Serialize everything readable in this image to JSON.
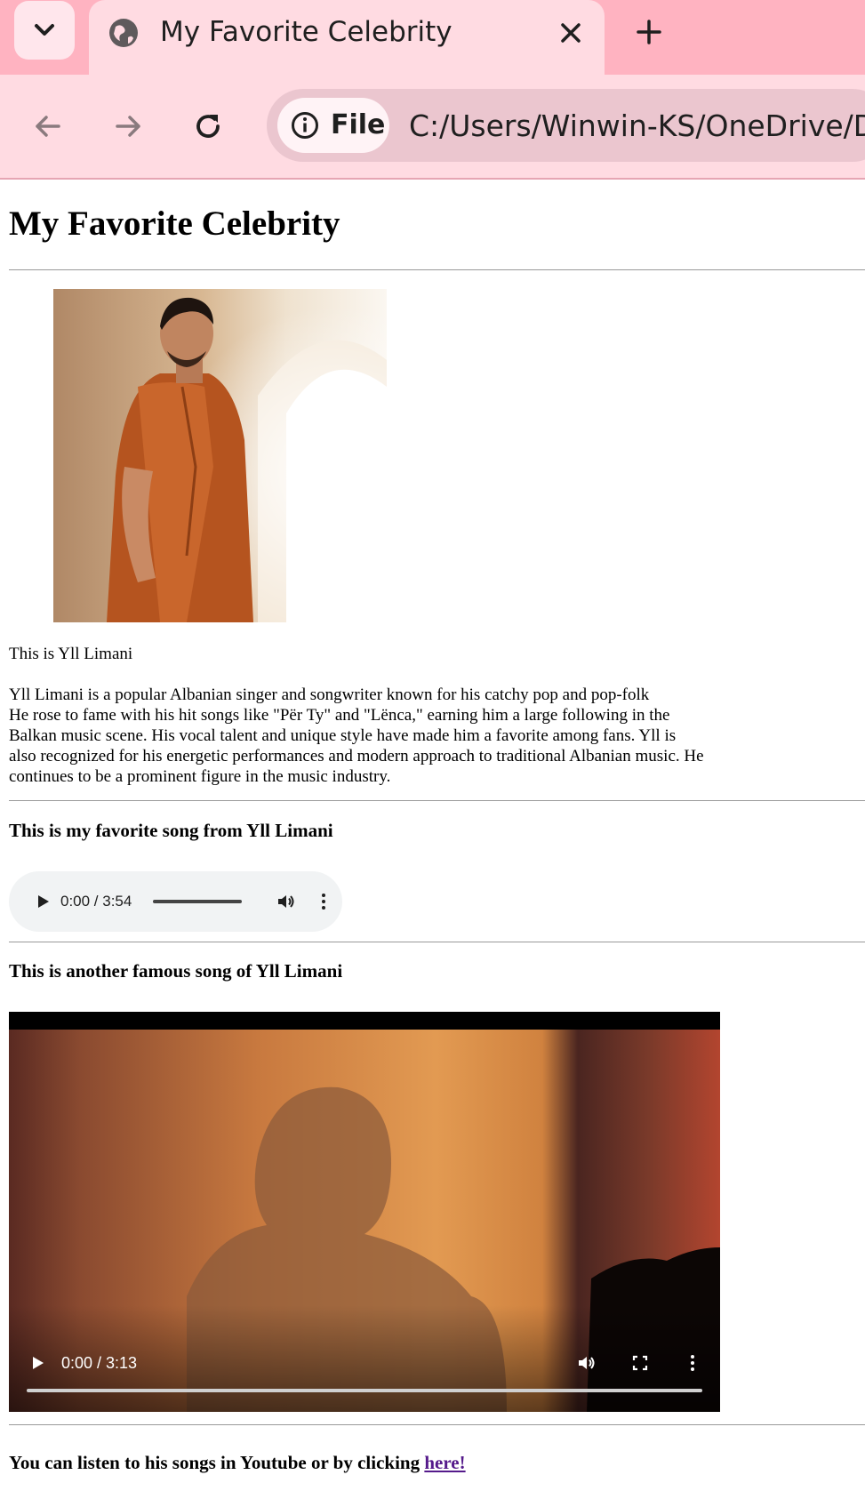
{
  "browser": {
    "tab": {
      "title": "My Favorite Celebrity",
      "close_icon": "close-icon",
      "favicon": "globe-icon"
    },
    "new_tab_icon": "plus-icon",
    "tab_search_icon": "chevron-down-icon",
    "nav": {
      "back_icon": "arrow-left-icon",
      "forward_icon": "arrow-right-icon",
      "reload_icon": "reload-icon"
    },
    "address": {
      "chip_label": "File",
      "chip_icon": "info-icon",
      "url": "C:/Users/Winwin-KS/OneDrive/Do"
    },
    "colors": {
      "tabstrip": "#ffb3c1",
      "toolbar": "#ffdbe2",
      "omnibox": "#ebc6cf"
    }
  },
  "page": {
    "title": "My Favorite Celebrity",
    "photo_alt": "Yll Limani",
    "caption": "This is Yll Limani",
    "bio_lines": [
      "Yll Limani is a popular Albanian singer and songwriter known for his catchy pop and pop-folk",
      "He rose to fame with his hit songs like \"Për Ty\" and \"Lënca,\" earning him a large following in the",
      "Balkan music scene. His vocal talent and unique style have made him a favorite among fans. Yll is",
      "also recognized for his energetic performances and modern approach to traditional Albanian music. He",
      "continues to be a prominent figure in the music industry."
    ],
    "audio_section": {
      "heading": "This is my favorite song from Yll Limani",
      "time": "0:00 / 3:54"
    },
    "video_section": {
      "heading": "This is another famous song of Yll Limani",
      "time": "0:00 / 3:13"
    },
    "footer": {
      "text": "You can listen to his songs in Youtube or by clicking ",
      "link_label": "here!"
    },
    "link_color": "#551a8b"
  }
}
